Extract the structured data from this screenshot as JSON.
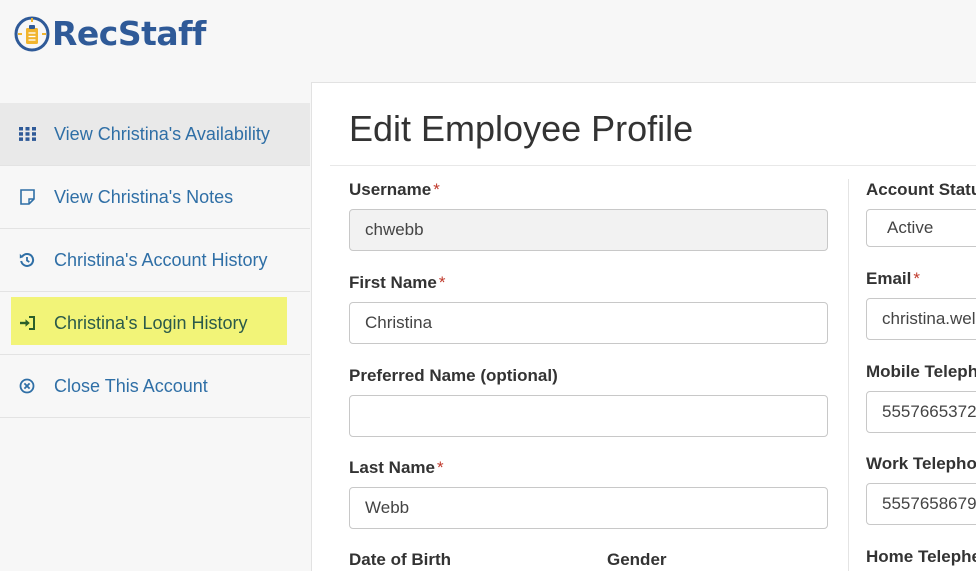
{
  "brand": {
    "name": "RecStaff",
    "logo_color": "#2f5a98",
    "accent_color": "#f1b52e"
  },
  "sidebar": {
    "items": [
      {
        "label": "View Christina's Availability",
        "icon": "grid-icon",
        "active": true
      },
      {
        "label": "View Christina's Notes",
        "icon": "note-icon"
      },
      {
        "label": "Christina's Account History",
        "icon": "history-icon"
      },
      {
        "label": "Christina's Login History",
        "icon": "sign-in-icon",
        "highlighted": true,
        "highlight_color": "#f2f478"
      },
      {
        "label": "Close This Account",
        "icon": "close-circle-icon"
      }
    ]
  },
  "main": {
    "title": "Edit Employee Profile",
    "required_marker": "*",
    "fields": {
      "username": {
        "label": "Username",
        "value": "chwebb",
        "required": true,
        "readonly": true
      },
      "first_name": {
        "label": "First Name",
        "value": "Christina",
        "required": true
      },
      "preferred_name": {
        "label": "Preferred Name (optional)",
        "value": ""
      },
      "last_name": {
        "label": "Last Name",
        "value": "Webb",
        "required": true
      },
      "date_of_birth": {
        "label": "Date of Birth"
      },
      "gender": {
        "label": "Gender"
      },
      "account_status": {
        "label": "Account Statu",
        "value": "Active"
      },
      "email": {
        "label": "Email",
        "value": "christina.wel",
        "required": true
      },
      "mobile_telephone": {
        "label": "Mobile Teleph",
        "value": "5557665372"
      },
      "work_telephone": {
        "label": "Work Telepho",
        "value": "5557658679"
      },
      "home_telephone": {
        "label": "Home Telephe"
      }
    }
  }
}
